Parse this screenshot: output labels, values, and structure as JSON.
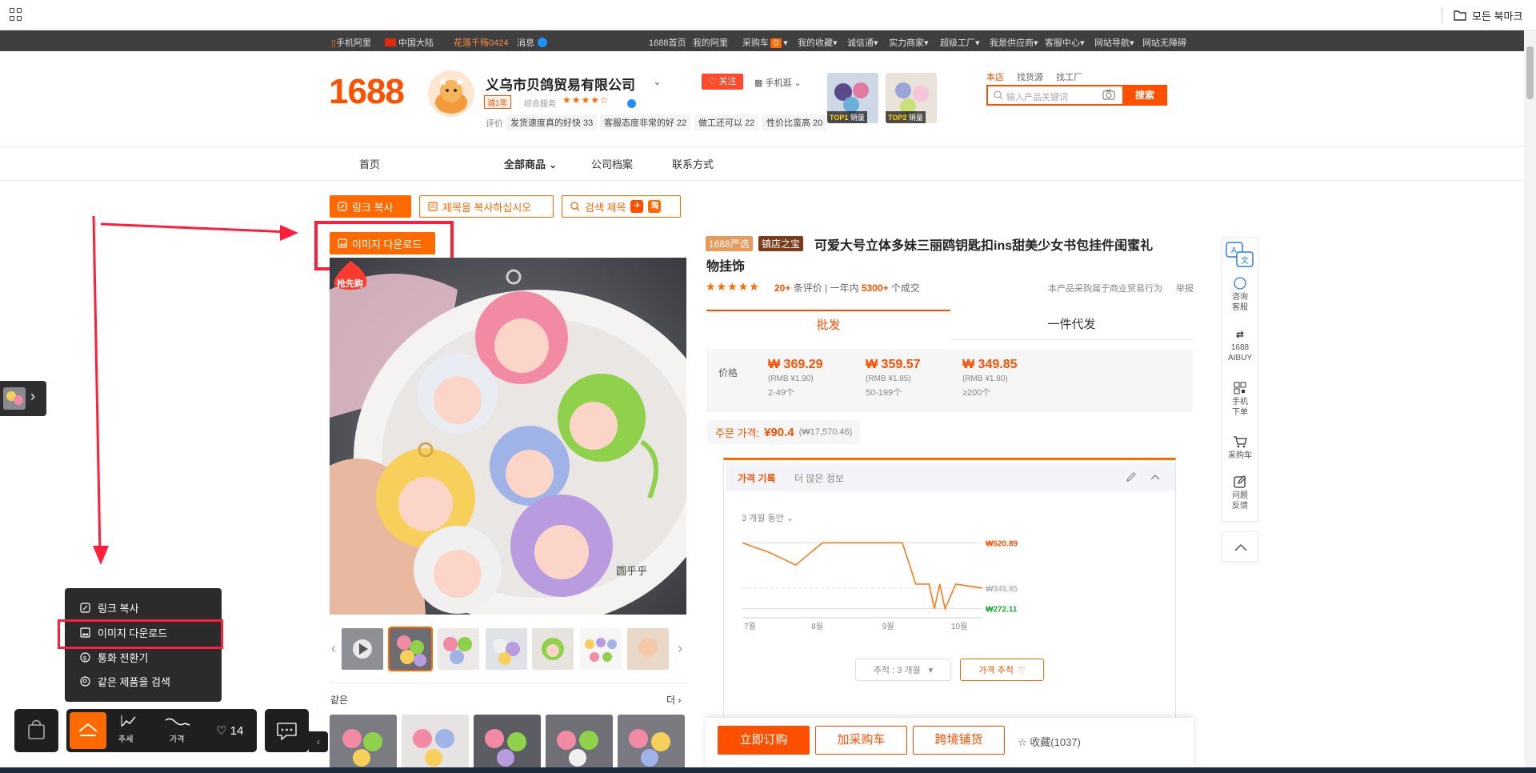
{
  "browser": {
    "all_bookmarks": "모든 북마크"
  },
  "topbar": {
    "mobile": "手机阿里",
    "region": "中国大陆",
    "promo": "花落千殇0424",
    "messages": "消息",
    "items": [
      "1688首页",
      "我的阿里",
      "采购车",
      "我的收藏",
      "诚信通",
      "实力商家",
      "超级工厂",
      "我是供应商",
      "客服中心",
      "网站导航",
      "网站无障碍"
    ],
    "cart_count": "0"
  },
  "header": {
    "logo": "1688",
    "shop_name": "义乌市贝鸽贸易有限公司",
    "year_badge": "诚1年",
    "composite_service": "综合服务",
    "stars": "★★★★☆",
    "rating_label": "评价",
    "tags": [
      "发货速度真的好快 33",
      "客服态度非常的好 22",
      "做工还可以 22",
      "性价比蛮高 20"
    ],
    "follow": "关注",
    "mobile_shop": "手机逛",
    "top1": "TOP1",
    "top2": "TOP2",
    "sales": "销量",
    "search_tabs": [
      "本店",
      "找货源",
      "找工厂"
    ],
    "search_placeholder": "输入产品关键词",
    "search_button": "搜索"
  },
  "nav": {
    "home": "首页",
    "all_products": "全部商品",
    "company": "公司档案",
    "contact": "联系方式"
  },
  "actions": {
    "copy_link": "링크 복사",
    "copy_title": "제목을 복사하십시오",
    "search_title": "검색 제목",
    "download_image": "이미지 다운로드"
  },
  "image": {
    "hot_badge": "抢先购",
    "watermark": "圆乎乎"
  },
  "similar": {
    "label": "같은",
    "more": "더"
  },
  "product": {
    "badge_yx": "1688严选",
    "badge_zd": "镇店之宝",
    "title_line1": "可爱大号立体多妹三丽鸥钥匙扣ins甜美少女书包挂件闺蜜礼",
    "title_line2": "物挂饰",
    "stars": "★★★★★",
    "reviews_count": "20+",
    "reviews_label": "条评价",
    "year_label": "一年内",
    "sold_count": "5300+",
    "sold_label": "个成交",
    "trade_note": "本产品采购属于商业贸易行为",
    "report": "举报",
    "tab_wholesale": "批发",
    "tab_dropship": "一件代发",
    "price_label": "价格",
    "tiers": [
      {
        "price": "₩ 369.29",
        "rmb": "(RMB ¥1.90)",
        "qty": "2-49个"
      },
      {
        "price": "₩ 359.57",
        "rmb": "(RMB ¥1.85)",
        "qty": "50-199个"
      },
      {
        "price": "₩ 349.85",
        "rmb": "(RMB ¥1.80)",
        "qty": "≥200个"
      }
    ],
    "order_price_label": "주문 가격:",
    "order_price": "¥90.4",
    "order_price_krw": "(₩17,570.46)"
  },
  "history": {
    "tab_history": "가격 기록",
    "tab_more": "더 많은 정보",
    "range": "3 개월 동안",
    "track_select": "추적 : 3 개월",
    "track_button": "가격 추적"
  },
  "chart_data": {
    "type": "line",
    "x_labels": [
      "7월",
      "8월",
      "9월",
      "10월"
    ],
    "x": [
      0,
      10,
      20,
      30,
      40,
      50,
      60,
      65,
      70,
      72,
      74,
      76,
      80,
      90
    ],
    "values": [
      520.89,
      485,
      437,
      520.89,
      520.89,
      520.89,
      520.89,
      365,
      365,
      272.11,
      365,
      272.11,
      365,
      349.85
    ],
    "series_color": "#ff7a1a",
    "max_label": "₩520.89",
    "current_label": "₩349.85",
    "min_label": "₩272.11",
    "ylim": [
      250,
      540
    ],
    "grid": true
  },
  "buybar": {
    "buy_now": "立即订购",
    "add_cart": "加采购车",
    "cross_border": "跨境铺货",
    "collect": "收藏(1037)"
  },
  "right_tools": {
    "consult": "咨询客服",
    "aibuy_1": "1688",
    "aibuy_2": "AIBUY",
    "mobile_order": "手机下单",
    "cart": "采购车",
    "feedback": "问题反馈"
  },
  "popup": {
    "copy_link": "링크 복사",
    "download_image": "이미지 다운로드",
    "currency": "통화 전환기",
    "search_same": "같은 제품을 검색"
  },
  "toolbar": {
    "trend": "추세",
    "price": "가격",
    "likes": "14"
  },
  "colors": {
    "brand": "#ff5000",
    "annotation": "#ff1f3b"
  }
}
